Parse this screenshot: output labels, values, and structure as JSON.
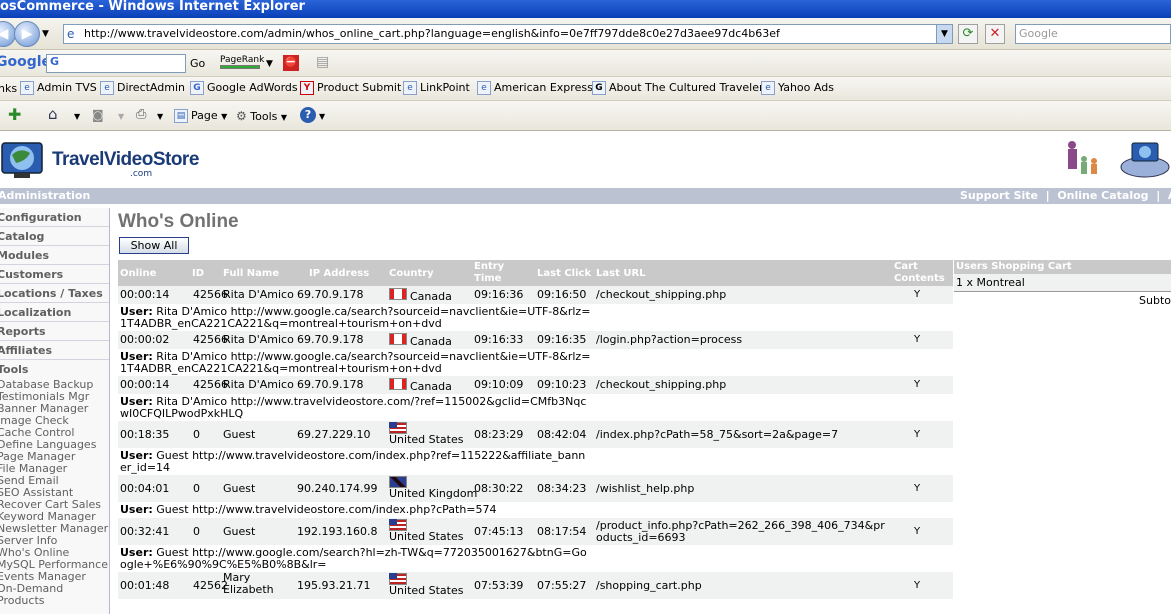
{
  "window": {
    "title": "osCommerce - Windows Internet Explorer"
  },
  "addressbar": {
    "url": "http://www.travelvideostore.com/admin/whos_online_cart.php?language=english&info=0e7ff797dde8c0e27d3aee97dc4b63ef",
    "search_placeholder": "Google"
  },
  "googlebar": {
    "logo": "Google",
    "go_label": "Go",
    "pagerank_label": "PageRank"
  },
  "links": [
    {
      "label": "nks",
      "icon": "links-icon"
    },
    {
      "label": "Admin TVS",
      "icon": "ie-page-icon"
    },
    {
      "label": "DirectAdmin",
      "icon": "ie-page-icon"
    },
    {
      "label": "Google AdWords",
      "icon": "google-g-icon"
    },
    {
      "label": "Product Submit",
      "icon": "yahoo-icon"
    },
    {
      "label": "LinkPoint",
      "icon": "ie-page-icon"
    },
    {
      "label": "American Express",
      "icon": "ie-page-icon"
    },
    {
      "label": "About The Cultured Traveler",
      "icon": "news-icon"
    },
    {
      "label": "Yahoo Ads",
      "icon": "ie-page-icon"
    }
  ],
  "commandbar": {
    "page_label": "Page",
    "tools_label": "Tools"
  },
  "site": {
    "logo_text": "TravelVideoStore",
    "logo_sub": ".com"
  },
  "header": {
    "left": "Administration",
    "right": "Support Site  |  Online Catalog  |  Adm"
  },
  "sidebar": {
    "boxes": [
      "Configuration",
      "Catalog",
      "Modules",
      "Customers",
      "Locations / Taxes",
      "Localization",
      "Reports",
      "Affiliates",
      "Tools"
    ],
    "tools_links": [
      "Database Backup",
      "Testimonials Mgr",
      "Banner Manager",
      "Image Check",
      "Cache Control",
      "Define Languages",
      "Page Manager",
      "File Manager",
      "Send Email",
      "SEO Assistant",
      "Recover Cart Sales",
      "Keyword Manager",
      "Newsletter Manager",
      "Server Info",
      "Who's Online",
      "MySQL Performance",
      "Events Manager",
      "On-Demand",
      "Products"
    ]
  },
  "main": {
    "title": "Who's Online",
    "show_all": "Show All",
    "columns": {
      "online": "Online",
      "id": "ID",
      "full_name": "Full Name",
      "ip": "IP Address",
      "country": "Country",
      "entry_time": "Entry Time",
      "last_click": "Last Click",
      "last_url": "Last URL",
      "cart": "Cart Contents"
    },
    "rows": [
      {
        "online": "00:00:14",
        "id": "42566",
        "name": "Rita D'Amico",
        "ip": "69.70.9.178",
        "flag": "ca",
        "country": "Canada",
        "entry": "09:16:36",
        "last": "09:16:50",
        "url": "/checkout_shipping.php",
        "cart": "Y",
        "user_label": "User:",
        "user_text": "Rita D'Amico http://www.google.ca/search?sourceid=navclient&ie=UTF-8&rlz=1T4ADBR_enCA221CA221&q=montreal+tourism+on+dvd"
      },
      {
        "online": "00:00:02",
        "id": "42566",
        "name": "Rita D'Amico",
        "ip": "69.70.9.178",
        "flag": "ca",
        "country": "Canada",
        "entry": "09:16:33",
        "last": "09:16:35",
        "url": "/login.php?action=process",
        "cart": "Y",
        "user_label": "User:",
        "user_text": "Rita D'Amico http://www.google.ca/search?sourceid=navclient&ie=UTF-8&rlz=1T4ADBR_enCA221CA221&q=montreal+tourism+on+dvd"
      },
      {
        "online": "00:00:14",
        "id": "42566",
        "name": "Rita D'Amico",
        "ip": "69.70.9.178",
        "flag": "ca",
        "country": "Canada",
        "entry": "09:10:09",
        "last": "09:10:23",
        "url": "/checkout_shipping.php",
        "cart": "Y",
        "user_label": "User:",
        "user_text": "Rita D'Amico http://www.travelvideostore.com/?ref=115002&gclid=CMfb3NqcwI0CFQILPwodPxkHLQ"
      },
      {
        "online": "00:18:35",
        "id": "0",
        "name": "Guest",
        "ip": "69.27.229.10",
        "flag": "us",
        "country": "United States",
        "entry": "08:23:29",
        "last": "08:42:04",
        "url": "/index.php?cPath=58_75&sort=2a&page=7",
        "cart": "Y",
        "user_label": "User:",
        "user_text": "Guest http://www.travelvideostore.com/index.php?ref=115222&affiliate_banner_id=14"
      },
      {
        "online": "00:04:01",
        "id": "0",
        "name": "Guest",
        "ip": "90.240.174.99",
        "flag": "uk",
        "country": "United Kingdom",
        "entry": "08:30:22",
        "last": "08:34:23",
        "url": "/wishlist_help.php",
        "cart": "Y",
        "user_label": "User:",
        "user_text": "Guest http://www.travelvideostore.com/index.php?cPath=574"
      },
      {
        "online": "00:32:41",
        "id": "0",
        "name": "Guest",
        "ip": "192.193.160.8",
        "flag": "us",
        "country": "United States",
        "entry": "07:45:13",
        "last": "08:17:54",
        "url": "/product_info.php?cPath=262_266_398_406_734&products_id=6693",
        "cart": "Y",
        "user_label": "User:",
        "user_text": "Guest http://www.google.com/search?hl=zh-TW&q=772035001627&btnG=Google+%E6%90%9C%E5%B0%8B&lr="
      },
      {
        "online": "00:01:48",
        "id": "42562",
        "name": "Mary Elizabeth",
        "ip": "195.93.21.71",
        "flag": "us",
        "country": "United States",
        "entry": "07:53:39",
        "last": "07:55:27",
        "url": "/shopping_cart.php",
        "cart": "Y",
        "user_label": "",
        "user_text": ""
      }
    ]
  },
  "cart": {
    "header": "Users Shopping Cart",
    "item": "1 x Montreal",
    "subtotal": "Subto"
  }
}
